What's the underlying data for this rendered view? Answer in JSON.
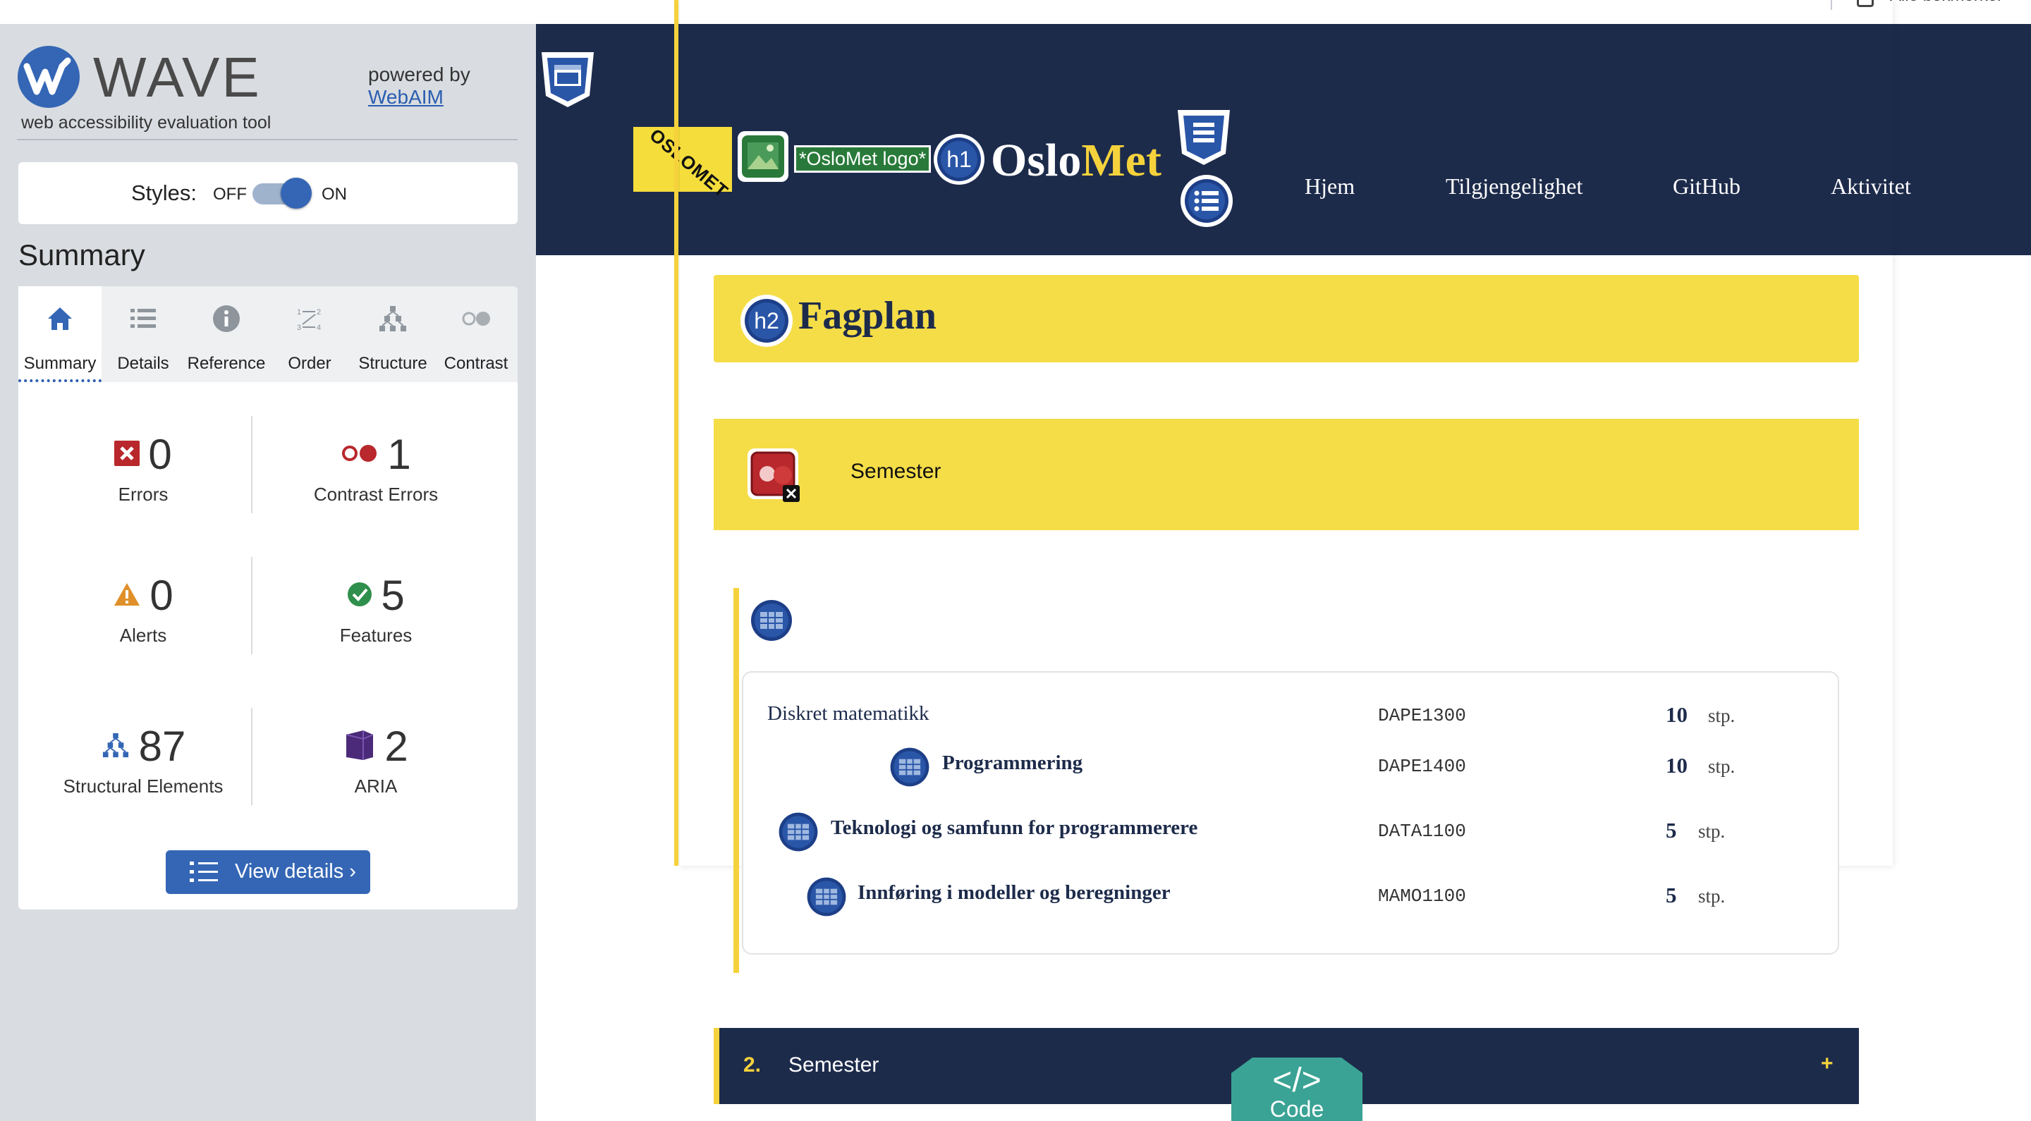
{
  "browser": {
    "bookmarks_label": "Alle bokmerker"
  },
  "wave": {
    "title": "WAVE",
    "subtitle": "web accessibility evaluation tool",
    "powered_by": "powered by",
    "webaim_link": "WebAIM",
    "styles": {
      "label": "Styles:",
      "off": "OFF",
      "on": "ON",
      "state": "on"
    },
    "summary_heading": "Summary",
    "tabs": [
      {
        "label": "Summary",
        "icon": "home-icon",
        "active": true
      },
      {
        "label": "Details",
        "icon": "list-icon"
      },
      {
        "label": "Reference",
        "icon": "info-icon"
      },
      {
        "label": "Order",
        "icon": "order-icon"
      },
      {
        "label": "Structure",
        "icon": "structure-icon"
      },
      {
        "label": "Contrast",
        "icon": "contrast-icon"
      }
    ],
    "stats": {
      "errors": {
        "value": "0",
        "label": "Errors"
      },
      "contrast_errors": {
        "value": "1",
        "label": "Contrast Errors"
      },
      "alerts": {
        "value": "0",
        "label": "Alerts"
      },
      "features": {
        "value": "5",
        "label": "Features"
      },
      "structural": {
        "value": "87",
        "label": "Structural Elements"
      },
      "aria": {
        "value": "2",
        "label": "ARIA"
      }
    },
    "view_details": "View details ›",
    "colors": {
      "accent": "#3466b5",
      "error": "#b8282c",
      "alert": "#e0902a",
      "feature": "#2f8f4c",
      "aria": "#4b2a7a"
    }
  },
  "page": {
    "logo_text": "OSLOMET",
    "alt_text_label": "*OsloMet logo*",
    "h1_badge": "h1",
    "h2_badge": "h2",
    "brand": {
      "part1": "Oslo",
      "part2": "Met"
    },
    "nav": [
      "Hjem",
      "Tilgjengelighet",
      "GitHub",
      "Aktivitet"
    ],
    "section_title": "Fagplan",
    "semester1": {
      "label": "Semester"
    },
    "courses": [
      {
        "name": "Diskret matematikk",
        "code": "DAPE1300",
        "points": "10",
        "unit": "stp."
      },
      {
        "name": "Programmering",
        "code": "DAPE1400",
        "points": "10",
        "unit": "stp."
      },
      {
        "name": "Teknologi og samfunn for programmerere",
        "code": "DATA1100",
        "points": "5",
        "unit": "stp."
      },
      {
        "name": "Innføring i modeller og beregninger",
        "code": "MAMO1100",
        "points": "5",
        "unit": "stp."
      }
    ],
    "semester2": {
      "number": "2.",
      "label": "Semester",
      "toggle": "+"
    },
    "code_tab": {
      "glyph": "</>",
      "label": "Code"
    },
    "colors": {
      "navy": "#1d2b4b",
      "yellow": "#f5dd48"
    }
  }
}
